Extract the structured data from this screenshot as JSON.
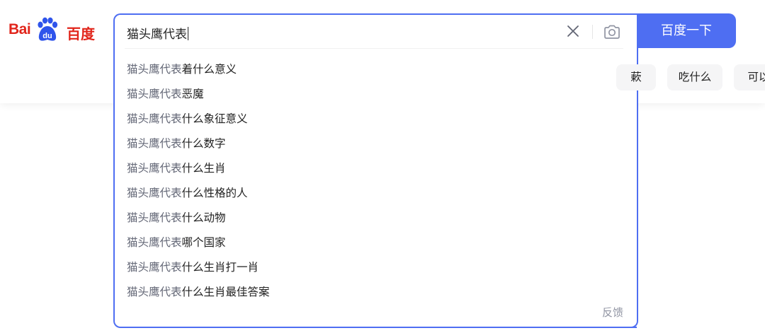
{
  "logo": {
    "latin": "Bai",
    "paw_text": "du",
    "chinese": "百度"
  },
  "search": {
    "query": "猫头鹰代表",
    "button_label": "百度一下",
    "clear_icon": "close-icon",
    "camera_icon": "camera-icon"
  },
  "suggestions": [
    {
      "prefix": "猫头鹰代表",
      "suffix": "着什么意义"
    },
    {
      "prefix": "猫头鹰代表",
      "suffix": "恶魔"
    },
    {
      "prefix": "猫头鹰代表",
      "suffix": "什么象征意义"
    },
    {
      "prefix": "猫头鹰代表",
      "suffix": "什么数字"
    },
    {
      "prefix": "猫头鹰代表",
      "suffix": "什么生肖"
    },
    {
      "prefix": "猫头鹰代表",
      "suffix": "什么性格的人"
    },
    {
      "prefix": "猫头鹰代表",
      "suffix": "什么动物"
    },
    {
      "prefix": "猫头鹰代表",
      "suffix": "哪个国家"
    },
    {
      "prefix": "猫头鹰代表",
      "suffix": "什么生肖打一肖"
    },
    {
      "prefix": "猫头鹰代表",
      "suffix": "什么生肖最佳答案"
    }
  ],
  "feedback_label": "反馈",
  "hot_tags": [
    "蔌",
    "吃什么",
    "可以"
  ],
  "colors": {
    "brand_blue": "#4e6ef2",
    "brand_red": "#e1251b",
    "muted_text": "#626675",
    "feedback_text": "#9195a3",
    "tag_bg": "#f5f5f6"
  }
}
